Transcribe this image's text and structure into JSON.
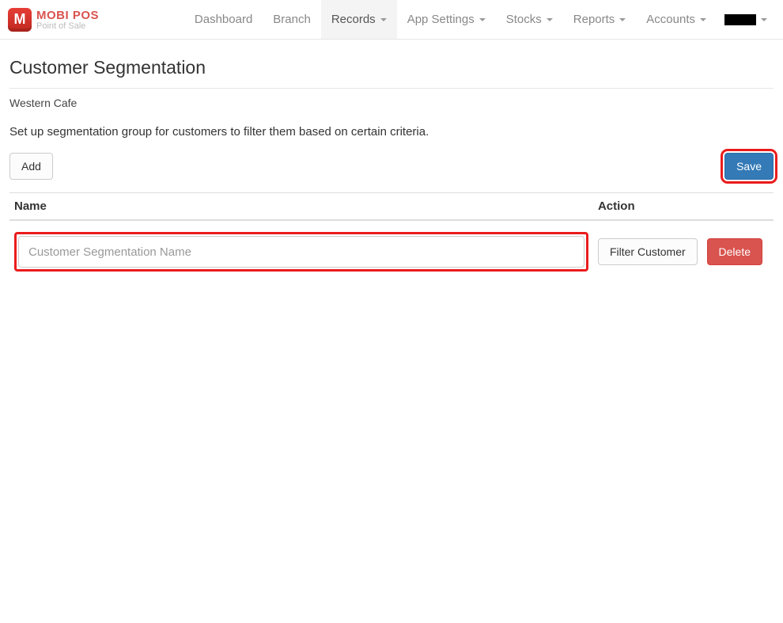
{
  "brand": {
    "name": "MOBI POS",
    "tagline": "Point of Sale"
  },
  "nav": {
    "items": [
      {
        "label": "Dashboard",
        "dropdown": false,
        "active": false
      },
      {
        "label": "Branch",
        "dropdown": false,
        "active": false
      },
      {
        "label": "Records",
        "dropdown": true,
        "active": true
      },
      {
        "label": "App Settings",
        "dropdown": true,
        "active": false
      },
      {
        "label": "Stocks",
        "dropdown": true,
        "active": false
      },
      {
        "label": "Reports",
        "dropdown": true,
        "active": false
      },
      {
        "label": "Accounts",
        "dropdown": true,
        "active": false
      }
    ]
  },
  "page": {
    "title": "Customer Segmentation",
    "branch": "Western Cafe",
    "description": "Set up segmentation group for customers to filter them based on certain criteria."
  },
  "toolbar": {
    "add_label": "Add",
    "save_label": "Save"
  },
  "table": {
    "headers": {
      "name": "Name",
      "action": "Action"
    },
    "rows": [
      {
        "name_value": "",
        "name_placeholder": "Customer Segmentation Name",
        "filter_label": "Filter Customer",
        "delete_label": "Delete"
      }
    ]
  }
}
